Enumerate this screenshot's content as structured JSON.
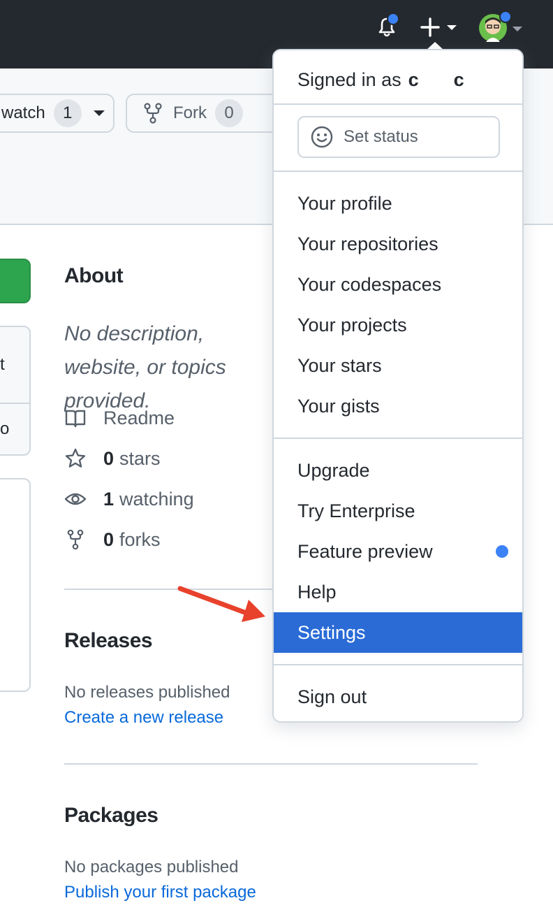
{
  "header": {
    "notifications_icon": "bell-icon",
    "create_icon": "plus-icon",
    "avatar_icon": "avatar"
  },
  "repo_actions": {
    "watch_label": "watch",
    "watch_count": "1",
    "fork_label": "Fork",
    "fork_count": "0"
  },
  "left_partial": {
    "item1": "t",
    "item2": "o"
  },
  "about": {
    "title": "About",
    "description": "No description, website, or topics provided.",
    "readme": "Readme",
    "stars_count": "0",
    "stars_label": "stars",
    "watching_count": "1",
    "watching_label": "watching",
    "forks_count": "0",
    "forks_label": "forks"
  },
  "releases": {
    "title": "Releases",
    "empty_text": "No releases published",
    "create_link": "Create a new release"
  },
  "packages": {
    "title": "Packages",
    "empty_text": "No packages published",
    "publish_link": "Publish your first package"
  },
  "menu": {
    "signed_in_prefix": "Signed in as",
    "username_start": "c",
    "username_end": "c",
    "set_status": "Set status",
    "items": [
      "Your profile",
      "Your repositories",
      "Your codespaces",
      "Your projects",
      "Your stars",
      "Your gists",
      "Upgrade",
      "Try Enterprise",
      "Feature preview",
      "Help",
      "Settings",
      "Sign out"
    ],
    "active_item": "Settings"
  },
  "colors": {
    "accent_blue": "#0969da",
    "active_menu_bg": "#2a6bd6",
    "notification_dot": "#3b82f6",
    "annotation_arrow": "#e8412c",
    "primary_green": "#2da44e"
  }
}
